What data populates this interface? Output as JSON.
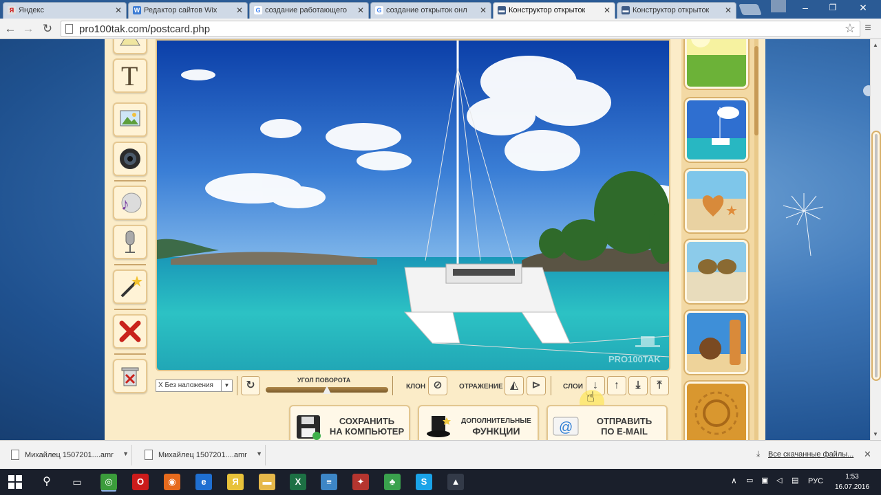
{
  "browser": {
    "tabs": [
      {
        "label": "Яндекс",
        "icon": "yandex-icon",
        "color": "#e0e0e0"
      },
      {
        "label": "Редактор сайтов Wix",
        "icon": "wix-icon",
        "color": "#3b7bd4"
      },
      {
        "label": "создание работающего",
        "icon": "google-icon",
        "color": "#ffffff"
      },
      {
        "label": "создание открыток онл",
        "icon": "google-icon",
        "color": "#ffffff"
      },
      {
        "label": "Конструктор открыток",
        "icon": "hat-icon",
        "color": "#3d5b86",
        "active": true
      },
      {
        "label": "Конструктор открыток",
        "icon": "hat-icon",
        "color": "#3d5b86"
      }
    ],
    "url": "pro100tak.com/postcard.php"
  },
  "editor": {
    "blend_mode": "Х Без наложения",
    "rotation_label": "УГОЛ ПОВОРОТА",
    "rotation_value": 0.5,
    "clone_label": "КЛОН",
    "mirror_label": "ОТРАЖЕНИЕ",
    "layer_label": "СЛОИ",
    "watermark": "PRO100TAK",
    "actions": {
      "save": [
        "СОХРАНИТЬ",
        "НА КОМПЬЮТЕР"
      ],
      "extra": [
        "ДОПОЛНИТЕЛЬНЫЕ",
        "ФУНКЦИИ"
      ],
      "send": [
        "ОТПРАВИТЬ",
        "ПО E-MAIL"
      ]
    },
    "tools": [
      "hex-icon",
      "text-tool-icon",
      "image-tool-icon",
      "camera-tool-icon",
      "music-tool-icon",
      "microphone-tool-icon",
      "magic-wand-icon",
      "delete-icon",
      "trash-icon"
    ],
    "tool_text": "T",
    "backgrounds": [
      "meadow",
      "yacht",
      "starfish-heart",
      "sunglasses",
      "coconut",
      "sand-sun"
    ]
  },
  "downloads": {
    "items": [
      "Михайлец 1507201....amr",
      "Михайлец 1507201....amr"
    ],
    "all_label": "Все скачанные файлы..."
  },
  "taskbar": {
    "language": "РУС",
    "time": "1:53",
    "date": "16.07.2016",
    "apps": [
      {
        "name": "chrome-icon",
        "color": "#3b9c3b",
        "glyph": "◎",
        "active": true
      },
      {
        "name": "opera-icon",
        "color": "#cc1b1b",
        "glyph": "O"
      },
      {
        "name": "firefox-icon",
        "color": "#e66a1d",
        "glyph": "◉"
      },
      {
        "name": "edge-icon",
        "color": "#1f6fd1",
        "glyph": "e"
      },
      {
        "name": "yandex-browser-icon",
        "color": "#e8c23a",
        "glyph": "Я"
      },
      {
        "name": "folder-icon",
        "color": "#e6b84a",
        "glyph": "▬"
      },
      {
        "name": "excel-icon",
        "color": "#1d7044",
        "glyph": "X"
      },
      {
        "name": "stack-app-icon",
        "color": "#3d86c6",
        "glyph": "≡"
      },
      {
        "name": "red-app-icon",
        "color": "#b5352f",
        "glyph": "✦"
      },
      {
        "name": "green-app-icon",
        "color": "#3aa14d",
        "glyph": "♣"
      },
      {
        "name": "skype-icon",
        "color": "#1aa3e8",
        "glyph": "S"
      },
      {
        "name": "photos-icon",
        "color": "#333a48",
        "glyph": "▲"
      }
    ]
  }
}
